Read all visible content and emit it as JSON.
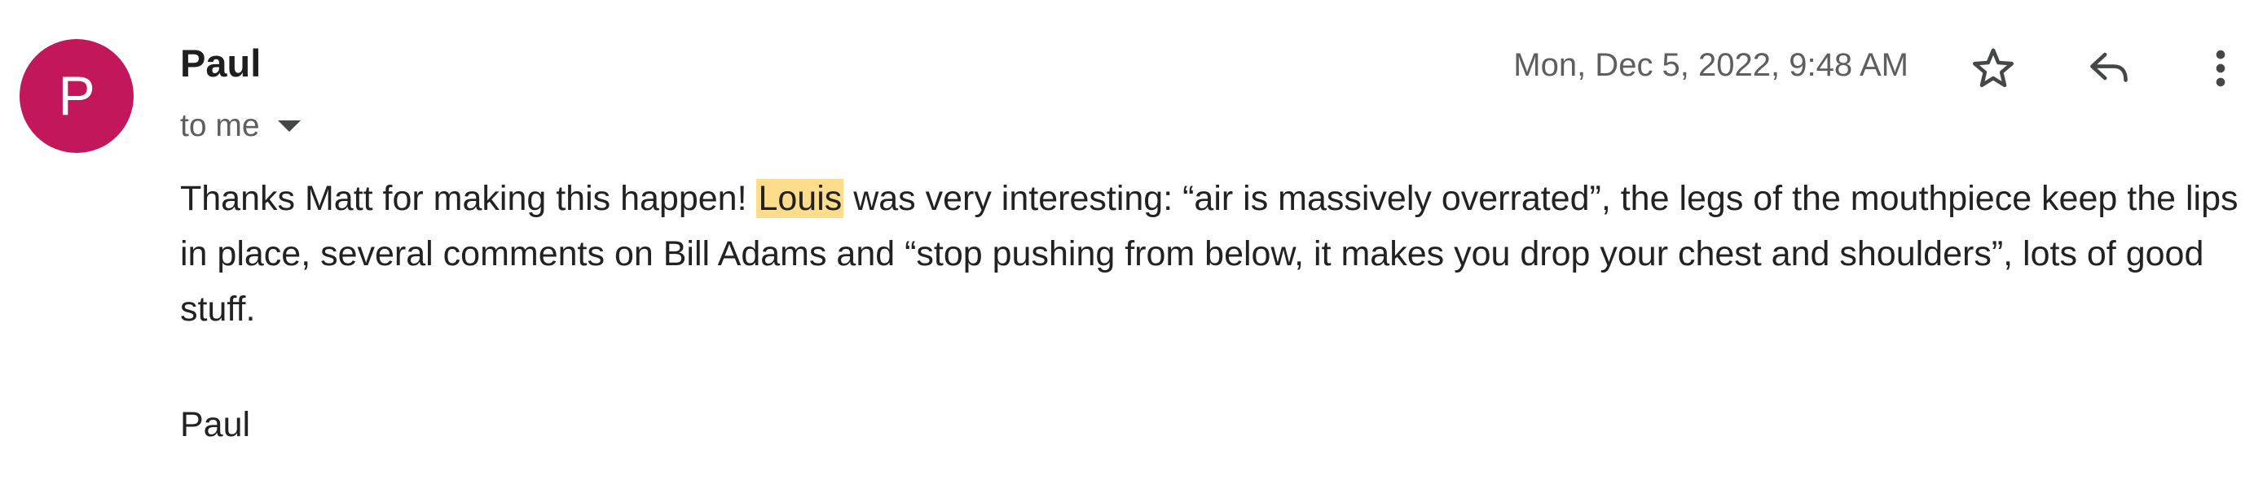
{
  "message": {
    "avatar": {
      "letter": "P",
      "color": "#c2185b"
    },
    "sender_name": "Paul",
    "recipient_label": "to me",
    "timestamp": "Mon, Dec 5, 2022, 9:48 AM",
    "icons": {
      "star": "star-outline-icon",
      "reply": "reply-icon",
      "more": "more-vertical-icon",
      "details": "chevron-down-icon"
    },
    "body": {
      "before_highlight": "Thanks Matt for making this happen! ",
      "highlight": "Louis",
      "after_highlight": " was very interesting: “air is massively overrated”, the legs of the mouthpiece keep the lips in place, several comments on Bill Adams and “stop pushing from below, it makes you drop your chest and shoulders”, lots of good stuff."
    },
    "signature": "Paul",
    "highlight_color": "#fddc8c"
  }
}
